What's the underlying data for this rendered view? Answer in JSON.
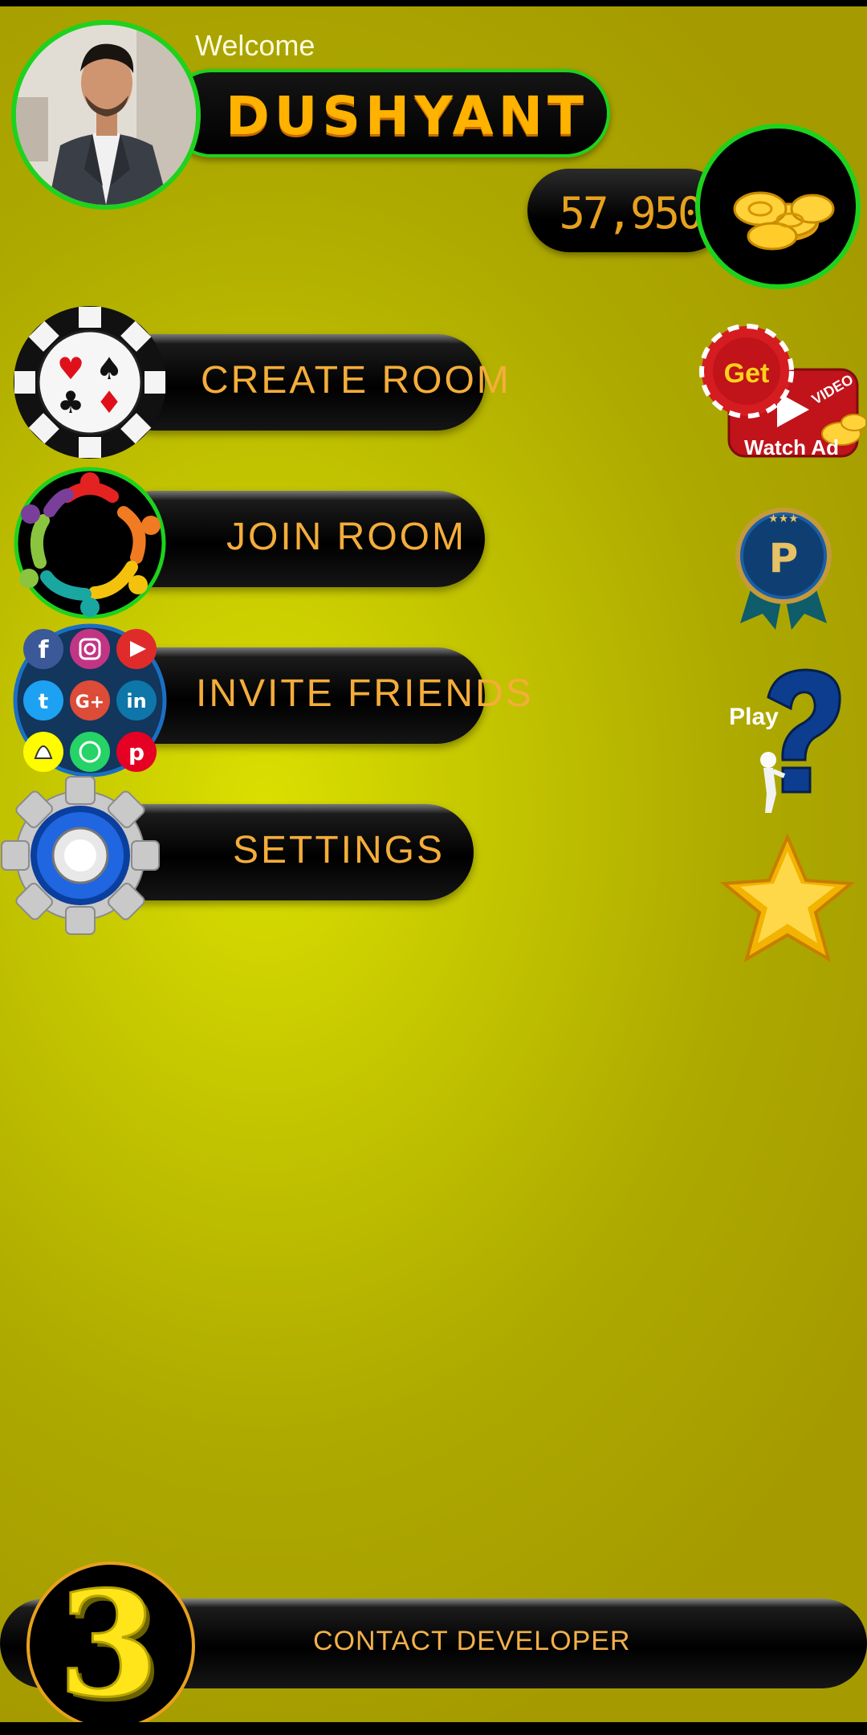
{
  "header": {
    "welcome_text": "Welcome",
    "player_name": "DUSHYANT",
    "coins": "57,950"
  },
  "menu": {
    "create_room": "CREATE ROOM",
    "join_room": "JOIN ROOM",
    "invite_friends": "INVITE FRIENDS",
    "settings": "SETTINGS"
  },
  "side_actions": {
    "watch_ad": {
      "get": "Get",
      "video": "VIDEO",
      "label": "Watch Ad"
    },
    "premium": {
      "letter": "P"
    },
    "how_to_play": {
      "label": "Play"
    }
  },
  "footer": {
    "contact_developer": "CONTACT DEVELOPER",
    "logo_digit": "3"
  },
  "colors": {
    "background": "#c5c700",
    "accent_green": "#1ed21e",
    "label_orange": "#f4ad3a",
    "name_gold": "#ffb200"
  },
  "social_icons": [
    "facebook-icon",
    "instagram-icon",
    "youtube-icon",
    "twitter-icon",
    "google-plus-icon",
    "linkedin-icon",
    "snapchat-icon",
    "whatsapp-icon",
    "pinterest-icon"
  ]
}
